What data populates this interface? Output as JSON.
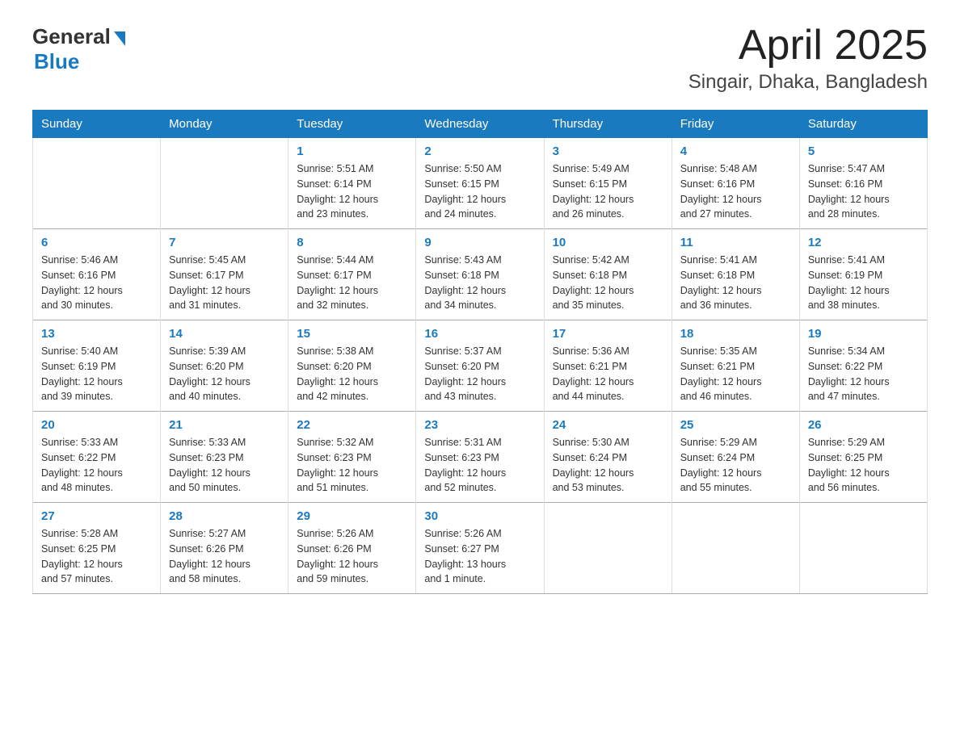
{
  "logo": {
    "general": "General",
    "blue": "Blue"
  },
  "title": "April 2025",
  "subtitle": "Singair, Dhaka, Bangladesh",
  "headers": [
    "Sunday",
    "Monday",
    "Tuesday",
    "Wednesday",
    "Thursday",
    "Friday",
    "Saturday"
  ],
  "weeks": [
    [
      {
        "day": "",
        "info": ""
      },
      {
        "day": "",
        "info": ""
      },
      {
        "day": "1",
        "info": "Sunrise: 5:51 AM\nSunset: 6:14 PM\nDaylight: 12 hours\nand 23 minutes."
      },
      {
        "day": "2",
        "info": "Sunrise: 5:50 AM\nSunset: 6:15 PM\nDaylight: 12 hours\nand 24 minutes."
      },
      {
        "day": "3",
        "info": "Sunrise: 5:49 AM\nSunset: 6:15 PM\nDaylight: 12 hours\nand 26 minutes."
      },
      {
        "day": "4",
        "info": "Sunrise: 5:48 AM\nSunset: 6:16 PM\nDaylight: 12 hours\nand 27 minutes."
      },
      {
        "day": "5",
        "info": "Sunrise: 5:47 AM\nSunset: 6:16 PM\nDaylight: 12 hours\nand 28 minutes."
      }
    ],
    [
      {
        "day": "6",
        "info": "Sunrise: 5:46 AM\nSunset: 6:16 PM\nDaylight: 12 hours\nand 30 minutes."
      },
      {
        "day": "7",
        "info": "Sunrise: 5:45 AM\nSunset: 6:17 PM\nDaylight: 12 hours\nand 31 minutes."
      },
      {
        "day": "8",
        "info": "Sunrise: 5:44 AM\nSunset: 6:17 PM\nDaylight: 12 hours\nand 32 minutes."
      },
      {
        "day": "9",
        "info": "Sunrise: 5:43 AM\nSunset: 6:18 PM\nDaylight: 12 hours\nand 34 minutes."
      },
      {
        "day": "10",
        "info": "Sunrise: 5:42 AM\nSunset: 6:18 PM\nDaylight: 12 hours\nand 35 minutes."
      },
      {
        "day": "11",
        "info": "Sunrise: 5:41 AM\nSunset: 6:18 PM\nDaylight: 12 hours\nand 36 minutes."
      },
      {
        "day": "12",
        "info": "Sunrise: 5:41 AM\nSunset: 6:19 PM\nDaylight: 12 hours\nand 38 minutes."
      }
    ],
    [
      {
        "day": "13",
        "info": "Sunrise: 5:40 AM\nSunset: 6:19 PM\nDaylight: 12 hours\nand 39 minutes."
      },
      {
        "day": "14",
        "info": "Sunrise: 5:39 AM\nSunset: 6:20 PM\nDaylight: 12 hours\nand 40 minutes."
      },
      {
        "day": "15",
        "info": "Sunrise: 5:38 AM\nSunset: 6:20 PM\nDaylight: 12 hours\nand 42 minutes."
      },
      {
        "day": "16",
        "info": "Sunrise: 5:37 AM\nSunset: 6:20 PM\nDaylight: 12 hours\nand 43 minutes."
      },
      {
        "day": "17",
        "info": "Sunrise: 5:36 AM\nSunset: 6:21 PM\nDaylight: 12 hours\nand 44 minutes."
      },
      {
        "day": "18",
        "info": "Sunrise: 5:35 AM\nSunset: 6:21 PM\nDaylight: 12 hours\nand 46 minutes."
      },
      {
        "day": "19",
        "info": "Sunrise: 5:34 AM\nSunset: 6:22 PM\nDaylight: 12 hours\nand 47 minutes."
      }
    ],
    [
      {
        "day": "20",
        "info": "Sunrise: 5:33 AM\nSunset: 6:22 PM\nDaylight: 12 hours\nand 48 minutes."
      },
      {
        "day": "21",
        "info": "Sunrise: 5:33 AM\nSunset: 6:23 PM\nDaylight: 12 hours\nand 50 minutes."
      },
      {
        "day": "22",
        "info": "Sunrise: 5:32 AM\nSunset: 6:23 PM\nDaylight: 12 hours\nand 51 minutes."
      },
      {
        "day": "23",
        "info": "Sunrise: 5:31 AM\nSunset: 6:23 PM\nDaylight: 12 hours\nand 52 minutes."
      },
      {
        "day": "24",
        "info": "Sunrise: 5:30 AM\nSunset: 6:24 PM\nDaylight: 12 hours\nand 53 minutes."
      },
      {
        "day": "25",
        "info": "Sunrise: 5:29 AM\nSunset: 6:24 PM\nDaylight: 12 hours\nand 55 minutes."
      },
      {
        "day": "26",
        "info": "Sunrise: 5:29 AM\nSunset: 6:25 PM\nDaylight: 12 hours\nand 56 minutes."
      }
    ],
    [
      {
        "day": "27",
        "info": "Sunrise: 5:28 AM\nSunset: 6:25 PM\nDaylight: 12 hours\nand 57 minutes."
      },
      {
        "day": "28",
        "info": "Sunrise: 5:27 AM\nSunset: 6:26 PM\nDaylight: 12 hours\nand 58 minutes."
      },
      {
        "day": "29",
        "info": "Sunrise: 5:26 AM\nSunset: 6:26 PM\nDaylight: 12 hours\nand 59 minutes."
      },
      {
        "day": "30",
        "info": "Sunrise: 5:26 AM\nSunset: 6:27 PM\nDaylight: 13 hours\nand 1 minute."
      },
      {
        "day": "",
        "info": ""
      },
      {
        "day": "",
        "info": ""
      },
      {
        "day": "",
        "info": ""
      }
    ]
  ]
}
